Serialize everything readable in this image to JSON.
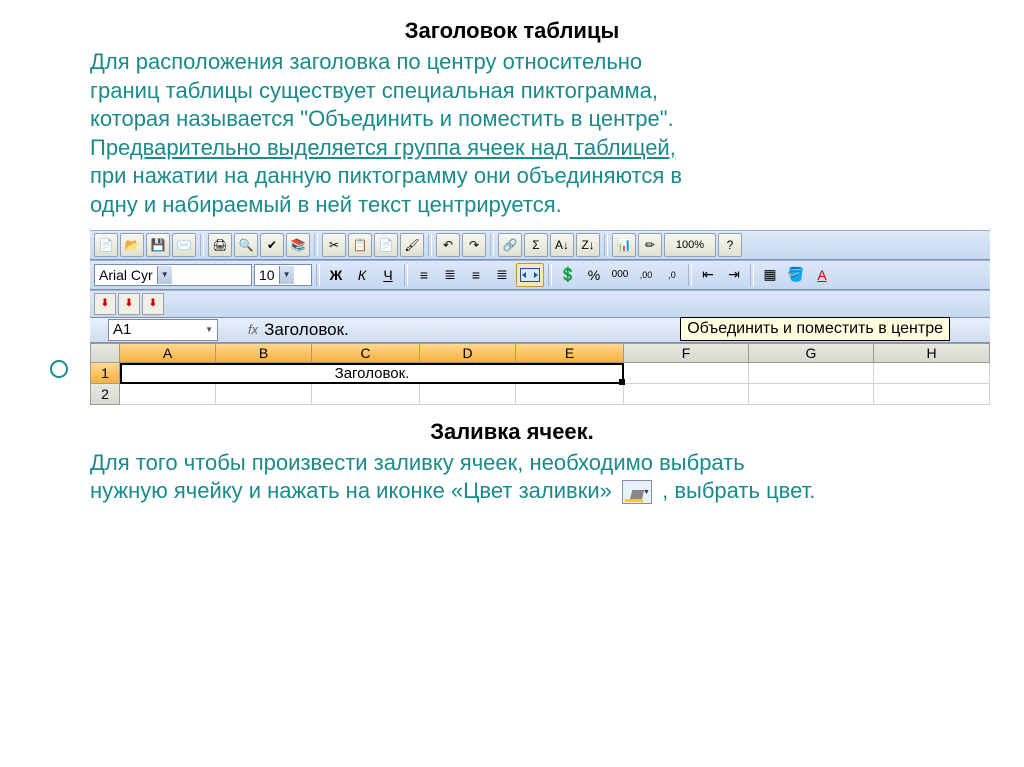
{
  "heading1": "Заголовок таблицы",
  "para1_line1": "Для расположения заголовка по центру относительно",
  "para1_line2": "границ таблицы существует специальная пиктограмма,",
  "para1_line3": "которая называется \"Объединить и поместить в центре\".",
  "para1_line4a": "Пре",
  "para1_line4b": "дварительно выделяется группа ячеек над таблицей,",
  "para1_line5": "при нажатии на данную пиктограмму они объединяются в",
  "para1_line6": "одну и набираемый в ней текст центрируется.",
  "toolbar": {
    "font_name": "Arial Cyr",
    "font_size": "10",
    "bold": "Ж",
    "italic": "К",
    "underline": "Ч",
    "currency": "%",
    "thousands": "000",
    "dec_inc": ",00",
    "dec_dec": ",0"
  },
  "tooltip_merge": "Объединить и поместить в центре",
  "namebox": "A1",
  "fx": "fx",
  "formula_value": "Заголовок.",
  "columns": [
    "A",
    "B",
    "C",
    "D",
    "E",
    "F",
    "G",
    "H"
  ],
  "rows": [
    "1",
    "2"
  ],
  "merged_text": "Заголовок.",
  "heading2": "Заливка ячеек.",
  "para2_line1": "Для того чтобы произвести заливку ячеек, необходимо выбрать",
  "para2_line2a": "нужную ячейку и нажать на иконке «Цвет заливки»",
  "para2_line2b": ", выбрать цвет."
}
